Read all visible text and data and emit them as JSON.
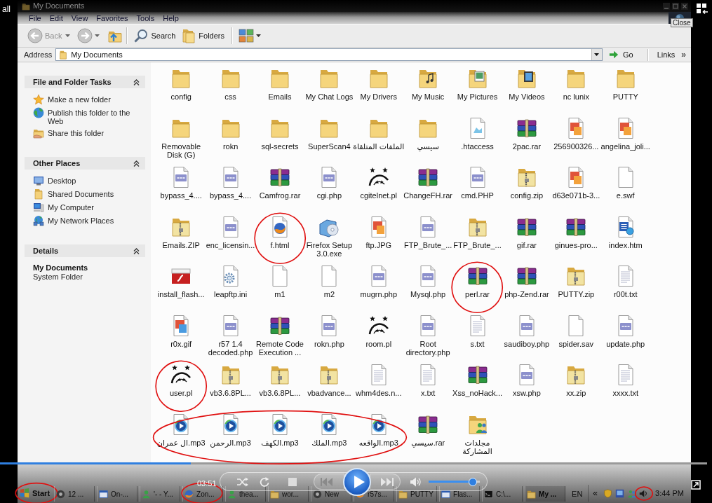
{
  "player": {
    "corner_label": "all",
    "time": "03:51",
    "playing": false,
    "seek": {
      "level": 0.27
    },
    "volume": {
      "level": 0.86
    }
  },
  "window": {
    "title": "My Documents",
    "tooltip": "Close"
  },
  "menu": [
    "File",
    "Edit",
    "View",
    "Favorites",
    "Tools",
    "Help"
  ],
  "toolbar": {
    "back": {
      "label": "Back",
      "disabled": true
    },
    "forward": {
      "disabled": true
    },
    "search": {
      "label": "Search"
    },
    "folders": {
      "label": "Folders"
    }
  },
  "address": {
    "label": "Address",
    "value": "My Documents",
    "go": "Go",
    "links": "Links",
    "more": "»"
  },
  "task_pane": [
    {
      "title": "File and Folder Tasks",
      "expanded": true,
      "kind": "links",
      "items": [
        {
          "label": "Make a new folder",
          "kind": "star"
        },
        {
          "label": "Publish this folder to the Web",
          "kind": "globe"
        },
        {
          "label": "Share this folder",
          "kind": "share"
        }
      ]
    },
    {
      "title": "Other Places",
      "expanded": true,
      "kind": "links",
      "items": [
        {
          "label": "Desktop",
          "kind": "desktop"
        },
        {
          "label": "Shared Documents",
          "kind": "folder"
        },
        {
          "label": "My Computer",
          "kind": "computer"
        },
        {
          "label": "My Network Places",
          "kind": "network"
        }
      ]
    },
    {
      "title": "Details",
      "expanded": true,
      "kind": "details",
      "name": "My Documents",
      "type": "System Folder"
    }
  ],
  "files": [
    {
      "name": "config",
      "kind": "folder",
      "circled": false
    },
    {
      "name": "css",
      "kind": "folder",
      "circled": false
    },
    {
      "name": "Emails",
      "kind": "folder",
      "circled": false
    },
    {
      "name": "My Chat Logs",
      "kind": "folder",
      "circled": false
    },
    {
      "name": "My Drivers",
      "kind": "folder",
      "circled": false
    },
    {
      "name": "My Music",
      "kind": "folder-music",
      "circled": false
    },
    {
      "name": "My Pictures",
      "kind": "folder-pictures",
      "circled": false
    },
    {
      "name": "My Videos",
      "kind": "folder-videos",
      "circled": false
    },
    {
      "name": "nc lunix",
      "kind": "folder",
      "circled": false
    },
    {
      "name": "PUTTY",
      "kind": "folder",
      "circled": false
    },
    {
      "name": "Removable Disk (G)",
      "kind": "folder",
      "circled": false
    },
    {
      "name": "rokn",
      "kind": "folder",
      "circled": false
    },
    {
      "name": "sql-secrets",
      "kind": "folder",
      "circled": false
    },
    {
      "name": "SuperScan4",
      "kind": "folder",
      "circled": false
    },
    {
      "name": "الملفات المتلقاة",
      "kind": "folder",
      "circled": false
    },
    {
      "name": "سيسي",
      "kind": "folder",
      "circled": false
    },
    {
      "name": ".htaccess",
      "kind": "document",
      "circled": false
    },
    {
      "name": "2pac.rar",
      "kind": "rar",
      "circled": false
    },
    {
      "name": "256900326...",
      "kind": "image",
      "circled": false
    },
    {
      "name": "angelina_joli...",
      "kind": "image",
      "circled": false
    },
    {
      "name": "bypass_4....",
      "kind": "php",
      "circled": false
    },
    {
      "name": "bypass_4....",
      "kind": "php",
      "circled": false
    },
    {
      "name": "Camfrog.rar",
      "kind": "rar",
      "circled": false
    },
    {
      "name": "cgi.php",
      "kind": "php",
      "circled": false
    },
    {
      "name": "cgitelnet.pl",
      "kind": "perl",
      "circled": false
    },
    {
      "name": "ChangeFH.rar",
      "kind": "rar",
      "circled": false
    },
    {
      "name": "cmd.PHP",
      "kind": "php",
      "circled": false
    },
    {
      "name": "config.zip",
      "kind": "zip",
      "circled": false
    },
    {
      "name": "d63e071b-3...",
      "kind": "image",
      "circled": false
    },
    {
      "name": "e.swf",
      "kind": "blank",
      "circled": false
    },
    {
      "name": "Emails.ZIP",
      "kind": "zip",
      "circled": false
    },
    {
      "name": "enc_licensin...",
      "kind": "php",
      "circled": false
    },
    {
      "name": "f.html",
      "kind": "browser",
      "circled": true
    },
    {
      "name": "Firefox Setup 3.0.exe",
      "kind": "installer",
      "circled": false
    },
    {
      "name": "ftp.JPG",
      "kind": "image",
      "circled": false
    },
    {
      "name": "FTP_Brute_...",
      "kind": "php",
      "circled": false
    },
    {
      "name": "FTP_Brute_...",
      "kind": "zip",
      "circled": false
    },
    {
      "name": "gif.rar",
      "kind": "rar",
      "circled": false
    },
    {
      "name": "ginues-pro...",
      "kind": "rar",
      "circled": false
    },
    {
      "name": "index.htm",
      "kind": "word",
      "circled": false
    },
    {
      "name": "install_flash...",
      "kind": "flash",
      "circled": false
    },
    {
      "name": "leapftp.ini",
      "kind": "ini",
      "circled": false
    },
    {
      "name": "m1",
      "kind": "blank",
      "circled": false
    },
    {
      "name": "m2",
      "kind": "blank",
      "circled": false
    },
    {
      "name": "mugrn.php",
      "kind": "php",
      "circled": false
    },
    {
      "name": "Mysql.php",
      "kind": "php",
      "circled": false
    },
    {
      "name": "perl.rar",
      "kind": "rar",
      "circled": true
    },
    {
      "name": "php-Zend.rar",
      "kind": "rar",
      "circled": false
    },
    {
      "name": "PUTTY.zip",
      "kind": "zip",
      "circled": false
    },
    {
      "name": "r00t.txt",
      "kind": "text",
      "circled": false
    },
    {
      "name": "r0x.gif",
      "kind": "gif",
      "circled": false
    },
    {
      "name": "r57 1.4 decoded.php",
      "kind": "php",
      "circled": false
    },
    {
      "name": "Remote Code Execution ...",
      "kind": "rar",
      "circled": false
    },
    {
      "name": "rokn.php",
      "kind": "php",
      "circled": false
    },
    {
      "name": "room.pl",
      "kind": "perl",
      "circled": false
    },
    {
      "name": "Root directory.php",
      "kind": "php",
      "circled": false
    },
    {
      "name": "s.txt",
      "kind": "text",
      "circled": false
    },
    {
      "name": "saudiboy.php",
      "kind": "php",
      "circled": false
    },
    {
      "name": "spider.sav",
      "kind": "blank",
      "circled": false
    },
    {
      "name": "update.php",
      "kind": "php",
      "circled": false
    },
    {
      "name": "user.pl",
      "kind": "perl",
      "circled": true
    },
    {
      "name": "vb3.6.8PL...",
      "kind": "zip",
      "circled": false
    },
    {
      "name": "vb3.6.8PL...",
      "kind": "zip",
      "circled": false
    },
    {
      "name": "vbadvance...",
      "kind": "zip",
      "circled": false
    },
    {
      "name": "whm4des.n...",
      "kind": "text",
      "circled": false
    },
    {
      "name": "x.txt",
      "kind": "text",
      "circled": false
    },
    {
      "name": "Xss_noHack...",
      "kind": "rar",
      "circled": false
    },
    {
      "name": "xsw.php",
      "kind": "php",
      "circled": false
    },
    {
      "name": "xx.zip",
      "kind": "zip",
      "circled": false
    },
    {
      "name": "xxxx.txt",
      "kind": "text",
      "circled": false
    },
    {
      "name": "ال عمران.mp3",
      "kind": "media",
      "circled": true
    },
    {
      "name": "الرحمن.mp3",
      "kind": "media",
      "circled": true
    },
    {
      "name": "الكهف.mp3",
      "kind": "media",
      "circled": true
    },
    {
      "name": "الملك.mp3",
      "kind": "media",
      "circled": true
    },
    {
      "name": "الواقعه.mp3",
      "kind": "media",
      "circled": true
    },
    {
      "name": "سيسي.rar",
      "kind": "rar",
      "circled": false
    },
    {
      "name": "مجلدات المشاركة",
      "kind": "shared-folder",
      "circled": false
    }
  ],
  "taskbar": {
    "start": {
      "label": "Start",
      "circled": true
    },
    "tasks": [
      {
        "label": "12 ...",
        "kind": "app",
        "active": false,
        "circled": false
      },
      {
        "label": "On-...",
        "kind": "window",
        "active": false,
        "circled": false
      },
      {
        "label": "'- - Y...",
        "kind": "messenger",
        "active": false,
        "circled": false
      },
      {
        "label": "Zon...",
        "kind": "browser",
        "active": false,
        "circled": true
      },
      {
        "label": "thea...",
        "kind": "messenger",
        "active": false,
        "circled": false
      },
      {
        "label": "wor...",
        "kind": "folder",
        "active": false,
        "circled": false
      },
      {
        "label": "New",
        "kind": "app",
        "active": false,
        "circled": false
      },
      {
        "label": "r57s...",
        "kind": "browser",
        "active": false,
        "circled": false
      },
      {
        "label": "PUTTY",
        "kind": "folder",
        "active": false,
        "circled": false
      },
      {
        "label": "Flas...",
        "kind": "window",
        "active": false,
        "circled": false
      },
      {
        "label": "C:\\...",
        "kind": "console",
        "active": false,
        "circled": false
      },
      {
        "label": "My ...",
        "kind": "folder",
        "active": true,
        "circled": false
      }
    ],
    "language": "EN",
    "tray": {
      "more": "«",
      "icons": [
        {
          "kind": "shield",
          "circled": false
        },
        {
          "kind": "monitor",
          "circled": false
        },
        {
          "kind": "people",
          "circled": false
        },
        {
          "kind": "speaker",
          "circled": true
        }
      ]
    },
    "clock": "3:44 PM"
  }
}
